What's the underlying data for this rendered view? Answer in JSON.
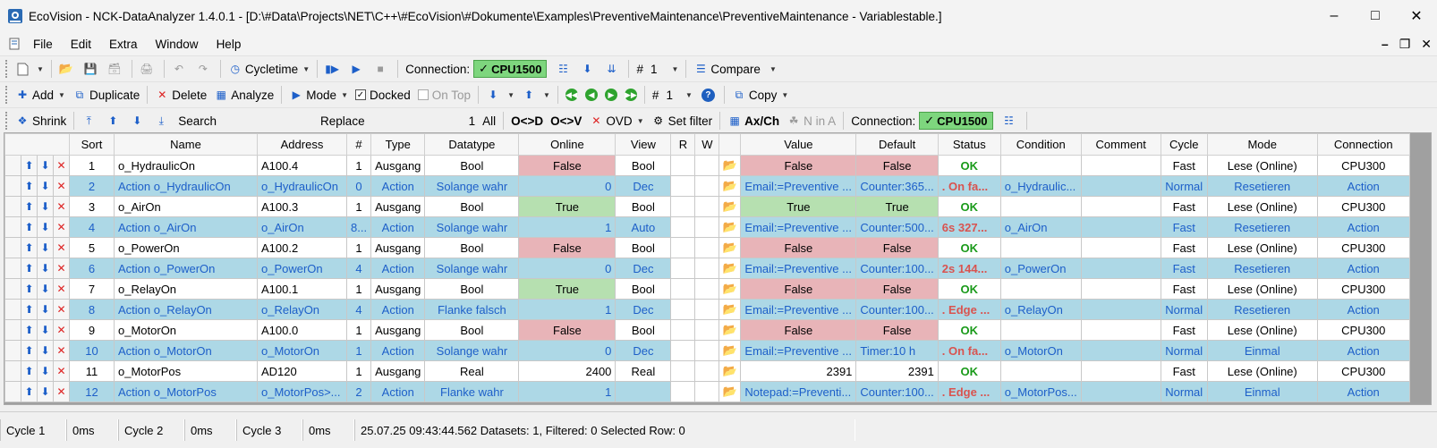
{
  "window": {
    "title": "EcoVision - NCK-DataAnalyzer 1.4.0.1 - [D:\\#Data\\Projects\\NET\\C++\\#EcoVision\\#Dokumente\\Examples\\PreventiveMaintenance\\PreventiveMaintenance - Variablestable.]"
  },
  "menu": [
    "File",
    "Edit",
    "Extra",
    "Window",
    "Help"
  ],
  "toolbar1": {
    "cycletime_label": "Cycletime",
    "connection_label": "Connection:",
    "connection_value": "CPU1500",
    "hash_label": "#",
    "hash_value": "1",
    "compare_label": "Compare"
  },
  "toolbar2": {
    "add_label": "Add",
    "duplicate_label": "Duplicate",
    "delete_label": "Delete",
    "analyze_label": "Analyze",
    "mode_label": "Mode",
    "docked_label": "Docked",
    "ontop_label": "On Top",
    "hash_label": "#",
    "hash_value": "1",
    "help_label": "?",
    "copy_label": "Copy"
  },
  "toolbar3": {
    "shrink_label": "Shrink",
    "search_label": "Search",
    "replace_label": "Replace",
    "count_value": "1",
    "all_label": "All",
    "o_d_label": "O<>D",
    "o_v_label": "O<>V",
    "ovd_label": "OVD",
    "set_filter_label": "Set filter",
    "axch_label": "Ax/Ch",
    "ninA_label": "N in A",
    "connection_label": "Connection:",
    "connection_value": "CPU1500"
  },
  "grid": {
    "columns": [
      "Sort",
      "Name",
      "Address",
      "#",
      "Type",
      "Datatype",
      "Online",
      "View",
      "R",
      "W",
      "",
      "Value",
      "Default",
      "Status",
      "Condition",
      "Comment",
      "Cycle",
      "Mode",
      "Connection"
    ],
    "rows": [
      {
        "sort": "1",
        "name": "o_HydraulicOn",
        "address": "A100.4",
        "num": "1",
        "type": "Ausgang",
        "datatype": "Bool",
        "online": "False",
        "view": "Bool",
        "value": "False",
        "default": "False",
        "status": "OK",
        "condition": "",
        "comment": "",
        "cycle": "Fast",
        "mode": "Lese (Online)",
        "connection": "CPU300"
      },
      {
        "sort": "2",
        "name": "Action o_HydraulicOn",
        "address": "o_HydraulicOn",
        "num": "0",
        "type": "Action",
        "datatype": "Solange wahr",
        "online": "0",
        "view": "Dec",
        "value": "Email:=Preventive ...",
        "default": "Counter:365...",
        "status": ". On fa...",
        "condition": "o_Hydraulic...",
        "comment": "",
        "cycle": "Normal",
        "mode": "Resetieren",
        "connection": "Action"
      },
      {
        "sort": "3",
        "name": "o_AirOn",
        "address": "A100.3",
        "num": "1",
        "type": "Ausgang",
        "datatype": "Bool",
        "online": "True",
        "view": "Bool",
        "value": "True",
        "default": "True",
        "status": "OK",
        "condition": "",
        "comment": "",
        "cycle": "Fast",
        "mode": "Lese (Online)",
        "connection": "CPU300"
      },
      {
        "sort": "4",
        "name": "Action o_AirOn",
        "address": "o_AirOn",
        "num": "8...",
        "type": "Action",
        "datatype": "Solange wahr",
        "online": "1",
        "view": "Auto",
        "value": "Email:=Preventive ...",
        "default": "Counter:500...",
        "status": "6s 327...",
        "condition": "o_AirOn",
        "comment": "",
        "cycle": "Fast",
        "mode": "Resetieren",
        "connection": "Action"
      },
      {
        "sort": "5",
        "name": "o_PowerOn",
        "address": "A100.2",
        "num": "1",
        "type": "Ausgang",
        "datatype": "Bool",
        "online": "False",
        "view": "Bool",
        "value": "False",
        "default": "False",
        "status": "OK",
        "condition": "",
        "comment": "",
        "cycle": "Fast",
        "mode": "Lese (Online)",
        "connection": "CPU300"
      },
      {
        "sort": "6",
        "name": "Action o_PowerOn",
        "address": "o_PowerOn",
        "num": "4",
        "type": "Action",
        "datatype": "Solange wahr",
        "online": "0",
        "view": "Dec",
        "value": "Email:=Preventive ...",
        "default": "Counter:100...",
        "status": "2s 144...",
        "condition": "o_PowerOn",
        "comment": "",
        "cycle": "Fast",
        "mode": "Resetieren",
        "connection": "Action"
      },
      {
        "sort": "7",
        "name": "o_RelayOn",
        "address": "A100.1",
        "num": "1",
        "type": "Ausgang",
        "datatype": "Bool",
        "online": "True",
        "view": "Bool",
        "value": "False",
        "default": "False",
        "status": "OK",
        "condition": "",
        "comment": "",
        "cycle": "Fast",
        "mode": "Lese (Online)",
        "connection": "CPU300"
      },
      {
        "sort": "8",
        "name": "Action o_RelayOn",
        "address": "o_RelayOn",
        "num": "4",
        "type": "Action",
        "datatype": "Flanke falsch",
        "online": "1",
        "view": "Dec",
        "value": "Email:=Preventive ...",
        "default": "Counter:100...",
        "status": ". Edge ...",
        "condition": "o_RelayOn",
        "comment": "",
        "cycle": "Normal",
        "mode": "Resetieren",
        "connection": "Action"
      },
      {
        "sort": "9",
        "name": "o_MotorOn",
        "address": "A100.0",
        "num": "1",
        "type": "Ausgang",
        "datatype": "Bool",
        "online": "False",
        "view": "Bool",
        "value": "False",
        "default": "False",
        "status": "OK",
        "condition": "",
        "comment": "",
        "cycle": "Fast",
        "mode": "Lese (Online)",
        "connection": "CPU300"
      },
      {
        "sort": "10",
        "name": "Action o_MotorOn",
        "address": "o_MotorOn",
        "num": "1",
        "type": "Action",
        "datatype": "Solange wahr",
        "online": "0",
        "view": "Dec",
        "value": "Email:=Preventive ...",
        "default": "Timer:10 h",
        "status": ". On fa...",
        "condition": "o_MotorOn",
        "comment": "",
        "cycle": "Normal",
        "mode": "Einmal",
        "connection": "Action"
      },
      {
        "sort": "11",
        "name": "o_MotorPos",
        "address": "AD120",
        "num": "1",
        "type": "Ausgang",
        "datatype": "Real",
        "online": "2400",
        "view": "Real",
        "value": "2391",
        "default": "2391",
        "status": "OK",
        "condition": "",
        "comment": "",
        "cycle": "Fast",
        "mode": "Lese (Online)",
        "connection": "CPU300"
      },
      {
        "sort": "12",
        "name": "Action o_MotorPos",
        "address": "o_MotorPos>...",
        "num": "2",
        "type": "Action",
        "datatype": "Flanke wahr",
        "online": "1",
        "view": "",
        "value": "Notepad:=Preventi...",
        "default": "Counter:100...",
        "status": ". Edge ...",
        "condition": "o_MotorPos...",
        "comment": "",
        "cycle": "Normal",
        "mode": "Einmal",
        "connection": "Action"
      }
    ]
  },
  "statusbar": {
    "cycle1_label": "Cycle 1",
    "cycle1_value": "0ms",
    "cycle2_label": "Cycle 2",
    "cycle2_value": "0ms",
    "cycle3_label": "Cycle 3",
    "cycle3_value": "0ms",
    "info": "25.07.25 09:43:44.562 Datasets: 1, Filtered: 0 Selected Row: 0"
  },
  "colors": {
    "row_blue": "#add8e6",
    "cell_red": "#e8b4b8",
    "cell_green": "#b6e0b0",
    "status_ok": "#1a9a1a",
    "status_warn": "#d9534f",
    "connection_badge": "#7ed67e"
  }
}
